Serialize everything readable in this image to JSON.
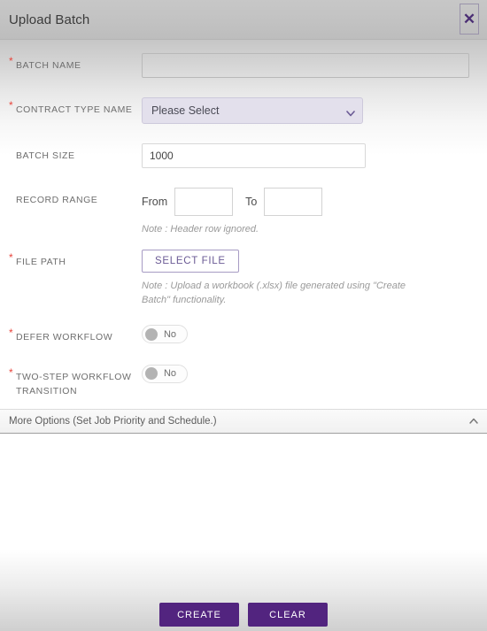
{
  "header": {
    "title": "Upload Batch",
    "close_icon": "close-icon",
    "close_glyph": "✕"
  },
  "form": {
    "fields": [
      {
        "key": "batch_name",
        "label": "BATCH NAME",
        "required": true,
        "value": "",
        "placeholder": ""
      },
      {
        "key": "contract_type_name",
        "label": "CONTRACT TYPE NAME",
        "required": true,
        "selected": "Please Select",
        "caret_icon": "chevron-down-icon"
      },
      {
        "key": "batch_size",
        "label": "BATCH SIZE",
        "required": false,
        "value": "1000",
        "placeholder": ""
      },
      {
        "key": "record_range",
        "label": "RECORD RANGE",
        "required": false,
        "from_label": "From",
        "from_value": "",
        "to_label": "To",
        "to_value": "",
        "note": "Note : Header row ignored."
      },
      {
        "key": "file_path",
        "label": "FILE PATH",
        "required": true,
        "button_label": "SELECT FILE",
        "note": "Note : Upload a workbook (.xlsx) file generated using \"Create Batch\" functionality."
      },
      {
        "key": "defer_workflow",
        "label": "DEFER WORKFLOW",
        "required": true,
        "toggle_state": "No"
      },
      {
        "key": "two_step_workflow_transition",
        "label": "TWO-STEP WORKFLOW TRANSITION",
        "required": true,
        "toggle_state": "No"
      }
    ]
  },
  "more_options": {
    "label": "More Options (Set Job Priority and Schedule.)",
    "chevron_icon": "chevron-up-icon"
  },
  "footer": {
    "create_label": "CREATE",
    "clear_label": "CLEAR"
  },
  "colors": {
    "accent_purple": "#52247f",
    "link_purple": "#6b5b95",
    "required_red": "#e8453c",
    "select_bg": "#e3e0ec"
  }
}
